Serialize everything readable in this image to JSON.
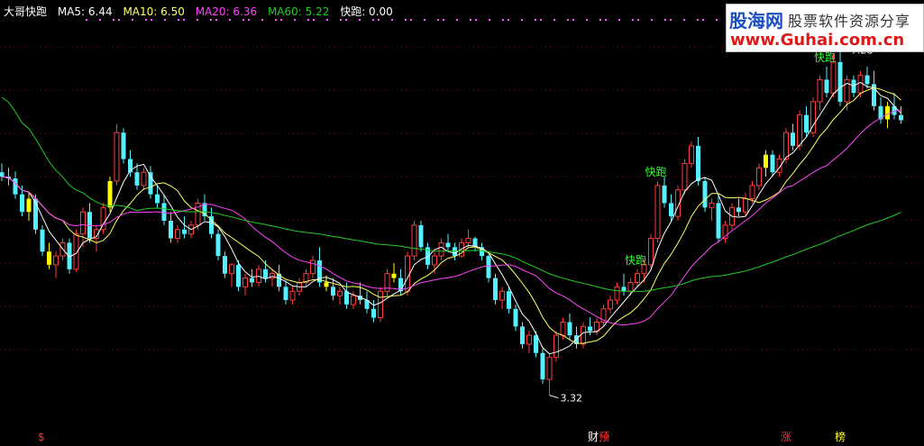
{
  "legend": {
    "title": "大哥快跑",
    "ma5": "MA5: 6.44",
    "ma10": "MA10: 6.50",
    "ma20": "MA20: 6.36",
    "ma60": "MA60: 5.22",
    "kuaipao": "快跑: 0.00"
  },
  "watermark": {
    "brand": "股海网",
    "slogan": "股票软件资源分享",
    "url": "www.Guhai.com.cn"
  },
  "colors": {
    "background": "#000000",
    "up": "#ff3b3b",
    "down": "#54f0ff",
    "signal": "#ffff00",
    "ma5": "#ffffff",
    "ma10": "#ffff66",
    "ma20": "#ff44ff",
    "ma60": "#22cc22",
    "label": "#33ff33",
    "grid": "#7a0000"
  },
  "chart_data": {
    "type": "candlestick",
    "y_range": [
      3.0,
      7.6
    ],
    "grid": true,
    "annotations": {
      "high_value": "7.28",
      "low_value": "3.32",
      "kuaipao_label": "快跑",
      "signal_texts": [
        "快跑",
        "快跑",
        "快跑"
      ]
    },
    "bottom_markers": [
      "$",
      "财",
      "预",
      "涨",
      "榜"
    ],
    "ohlc": [
      [
        5.85,
        5.95,
        5.75,
        5.8
      ],
      [
        5.8,
        5.9,
        5.7,
        5.78
      ],
      [
        5.78,
        5.86,
        5.55,
        5.6
      ],
      [
        5.6,
        5.7,
        5.35,
        5.4
      ],
      [
        5.4,
        5.62,
        5.3,
        5.55
      ],
      [
        5.55,
        5.6,
        5.15,
        5.2
      ],
      [
        5.2,
        5.25,
        4.9,
        4.95
      ],
      [
        4.95,
        5.05,
        4.75,
        4.8
      ],
      [
        4.8,
        4.95,
        4.65,
        4.9
      ],
      [
        4.9,
        5.1,
        4.85,
        5.05
      ],
      [
        5.05,
        5.1,
        4.7,
        4.75
      ],
      [
        4.75,
        5.2,
        4.72,
        5.15
      ],
      [
        5.15,
        5.45,
        5.0,
        5.4
      ],
      [
        5.4,
        5.5,
        5.05,
        5.1
      ],
      [
        5.1,
        5.25,
        4.95,
        5.2
      ],
      [
        5.2,
        5.5,
        5.15,
        5.45
      ],
      [
        5.45,
        5.8,
        5.4,
        5.75
      ],
      [
        5.75,
        6.4,
        5.7,
        6.3
      ],
      [
        6.3,
        6.35,
        5.95,
        6.0
      ],
      [
        6.0,
        6.1,
        5.8,
        5.85
      ],
      [
        5.85,
        5.95,
        5.65,
        5.7
      ],
      [
        5.7,
        5.9,
        5.65,
        5.85
      ],
      [
        5.85,
        5.92,
        5.55,
        5.6
      ],
      [
        5.6,
        5.7,
        5.45,
        5.5
      ],
      [
        5.5,
        5.6,
        5.25,
        5.3
      ],
      [
        5.3,
        5.4,
        5.05,
        5.1
      ],
      [
        5.1,
        5.25,
        5.05,
        5.2
      ],
      [
        5.2,
        5.35,
        5.1,
        5.15
      ],
      [
        5.15,
        5.3,
        5.1,
        5.25
      ],
      [
        5.25,
        5.55,
        5.2,
        5.5
      ],
      [
        5.5,
        5.6,
        5.3,
        5.35
      ],
      [
        5.35,
        5.45,
        5.1,
        5.15
      ],
      [
        5.15,
        5.2,
        4.85,
        4.9
      ],
      [
        4.9,
        4.95,
        4.65,
        4.7
      ],
      [
        4.7,
        4.82,
        4.55,
        4.8
      ],
      [
        4.8,
        4.85,
        4.5,
        4.55
      ],
      [
        4.55,
        4.7,
        4.45,
        4.65
      ],
      [
        4.65,
        4.75,
        4.55,
        4.6
      ],
      [
        4.6,
        4.8,
        4.55,
        4.75
      ],
      [
        4.75,
        4.85,
        4.6,
        4.65
      ],
      [
        4.65,
        4.75,
        4.55,
        4.7
      ],
      [
        4.7,
        4.8,
        4.5,
        4.55
      ],
      [
        4.55,
        4.62,
        4.35,
        4.4
      ],
      [
        4.4,
        4.55,
        4.35,
        4.5
      ],
      [
        4.5,
        4.65,
        4.45,
        4.6
      ],
      [
        4.6,
        4.75,
        4.55,
        4.7
      ],
      [
        4.7,
        4.9,
        4.65,
        4.85
      ],
      [
        4.85,
        5.0,
        4.55,
        4.6
      ],
      [
        4.6,
        4.68,
        4.5,
        4.55
      ],
      [
        4.55,
        4.65,
        4.4,
        4.45
      ],
      [
        4.45,
        4.55,
        4.35,
        4.5
      ],
      [
        4.5,
        4.6,
        4.3,
        4.35
      ],
      [
        4.35,
        4.5,
        4.3,
        4.45
      ],
      [
        4.45,
        4.6,
        4.35,
        4.4
      ],
      [
        4.4,
        4.5,
        4.25,
        4.3
      ],
      [
        4.3,
        4.4,
        4.15,
        4.2
      ],
      [
        4.2,
        4.55,
        4.15,
        4.5
      ],
      [
        4.5,
        4.75,
        4.45,
        4.7
      ],
      [
        4.7,
        4.82,
        4.6,
        4.65
      ],
      [
        4.65,
        4.75,
        4.45,
        4.5
      ],
      [
        4.5,
        4.95,
        4.45,
        4.9
      ],
      [
        4.9,
        5.3,
        4.85,
        5.25
      ],
      [
        5.25,
        5.3,
        4.95,
        5.0
      ],
      [
        5.0,
        5.05,
        4.75,
        4.8
      ],
      [
        4.8,
        4.95,
        4.7,
        4.9
      ],
      [
        4.9,
        5.1,
        4.85,
        5.05
      ],
      [
        5.05,
        5.15,
        4.95,
        5.0
      ],
      [
        5.0,
        5.05,
        4.85,
        4.9
      ],
      [
        4.9,
        5.1,
        4.88,
        5.05
      ],
      [
        5.05,
        5.2,
        5.0,
        5.1
      ],
      [
        5.1,
        5.12,
        4.95,
        5.0
      ],
      [
        5.0,
        5.05,
        4.85,
        4.9
      ],
      [
        4.9,
        4.92,
        4.6,
        4.65
      ],
      [
        4.65,
        4.7,
        4.35,
        4.4
      ],
      [
        4.4,
        4.55,
        4.3,
        4.5
      ],
      [
        4.5,
        4.55,
        4.25,
        4.3
      ],
      [
        4.3,
        4.35,
        4.05,
        4.1
      ],
      [
        4.1,
        4.15,
        3.85,
        3.9
      ],
      [
        3.9,
        4.05,
        3.8,
        4.0
      ],
      [
        4.0,
        4.05,
        3.75,
        3.8
      ],
      [
        3.8,
        3.85,
        3.45,
        3.5
      ],
      [
        3.5,
        3.8,
        3.32,
        3.75
      ],
      [
        3.75,
        4.05,
        3.7,
        4.0
      ],
      [
        4.0,
        4.2,
        3.95,
        4.15
      ],
      [
        4.15,
        4.25,
        3.95,
        4.0
      ],
      [
        4.0,
        4.1,
        3.85,
        3.9
      ],
      [
        3.9,
        4.15,
        3.85,
        4.1
      ],
      [
        4.1,
        4.2,
        4.0,
        4.05
      ],
      [
        4.05,
        4.2,
        4.0,
        4.15
      ],
      [
        4.15,
        4.35,
        4.1,
        4.3
      ],
      [
        4.3,
        4.45,
        4.25,
        4.4
      ],
      [
        4.4,
        4.6,
        4.35,
        4.55
      ],
      [
        4.55,
        4.7,
        4.45,
        4.5
      ],
      [
        4.5,
        4.65,
        4.45,
        4.6
      ],
      [
        4.6,
        4.75,
        4.55,
        4.7
      ],
      [
        4.7,
        4.85,
        4.6,
        4.8
      ],
      [
        4.8,
        5.15,
        4.75,
        5.1
      ],
      [
        5.1,
        5.75,
        5.05,
        5.7
      ],
      [
        5.7,
        5.8,
        5.45,
        5.5
      ],
      [
        5.5,
        5.6,
        5.3,
        5.35
      ],
      [
        5.35,
        5.7,
        5.3,
        5.65
      ],
      [
        5.65,
        6.0,
        5.6,
        5.95
      ],
      [
        5.95,
        6.2,
        5.9,
        6.15
      ],
      [
        6.15,
        6.25,
        5.7,
        5.75
      ],
      [
        5.75,
        5.8,
        5.4,
        5.45
      ],
      [
        5.45,
        5.55,
        5.3,
        5.5
      ],
      [
        5.5,
        5.6,
        5.05,
        5.1
      ],
      [
        5.1,
        5.3,
        5.05,
        5.25
      ],
      [
        5.25,
        5.5,
        5.2,
        5.45
      ],
      [
        5.45,
        5.55,
        5.35,
        5.4
      ],
      [
        5.4,
        5.62,
        5.35,
        5.55
      ],
      [
        5.55,
        5.75,
        5.5,
        5.7
      ],
      [
        5.7,
        5.95,
        5.65,
        5.9
      ],
      [
        5.9,
        6.1,
        5.8,
        6.05
      ],
      [
        6.05,
        6.1,
        5.8,
        5.85
      ],
      [
        5.85,
        6.05,
        5.8,
        6.0
      ],
      [
        6.0,
        6.35,
        5.95,
        6.3
      ],
      [
        6.3,
        6.4,
        6.1,
        6.15
      ],
      [
        6.15,
        6.55,
        6.1,
        6.5
      ],
      [
        6.5,
        6.6,
        6.25,
        6.3
      ],
      [
        6.3,
        6.7,
        6.25,
        6.65
      ],
      [
        6.65,
        6.95,
        6.55,
        6.9
      ],
      [
        6.9,
        7.05,
        6.7,
        6.75
      ],
      [
        6.75,
        7.2,
        6.7,
        7.1
      ],
      [
        7.1,
        7.28,
        6.6,
        6.65
      ],
      [
        6.65,
        6.95,
        6.55,
        6.9
      ],
      [
        6.9,
        6.95,
        6.7,
        6.75
      ],
      [
        6.75,
        7.0,
        6.7,
        6.95
      ],
      [
        6.95,
        7.05,
        6.8,
        6.85
      ],
      [
        6.85,
        7.0,
        6.55,
        6.6
      ],
      [
        6.6,
        6.7,
        6.4,
        6.45
      ],
      [
        6.45,
        6.65,
        6.35,
        6.6
      ],
      [
        6.6,
        6.75,
        6.45,
        6.5
      ],
      [
        6.5,
        6.6,
        6.4,
        6.44
      ]
    ],
    "signal_bars": [
      4,
      7,
      16,
      48,
      58,
      113,
      131
    ],
    "signal_text_bars": [
      94,
      97,
      122
    ],
    "ma_periods": [
      5,
      10,
      20,
      60
    ]
  }
}
